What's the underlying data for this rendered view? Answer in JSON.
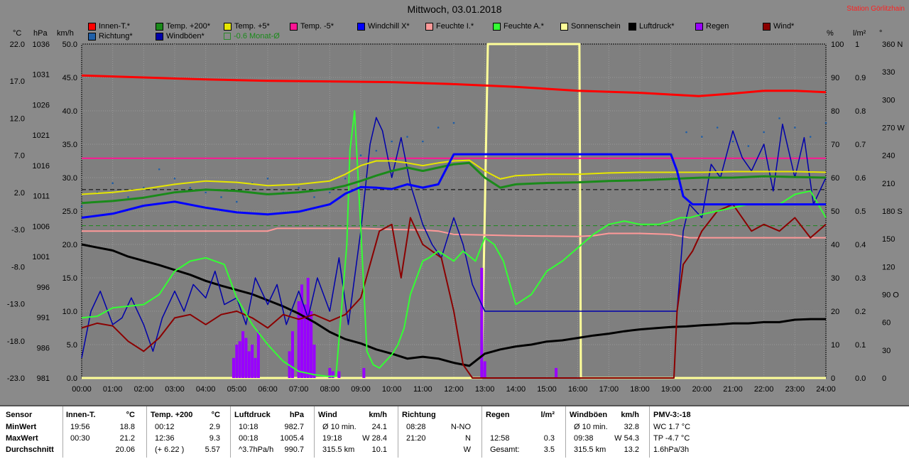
{
  "title": "Mittwoch, 03.01.2018",
  "station": "Station Görlitzhain",
  "units": {
    "c": "°C",
    "hpa": "hPa",
    "kmh": "km/h",
    "pct": "%",
    "lm2": "l/m²",
    "deg": "°"
  },
  "legend": [
    {
      "label": "Innen-T.*",
      "color": "#ff0000"
    },
    {
      "label": "Temp. +200*",
      "color": "#1a8a1a"
    },
    {
      "label": "Temp. +5*",
      "color": "#e6e600"
    },
    {
      "label": "Temp. -5*",
      "color": "#ff1493"
    },
    {
      "label": "Windchill X*",
      "color": "#0000ff"
    },
    {
      "label": "Feuchte I.*",
      "color": "#ff9999"
    },
    {
      "label": "Feuchte A.*",
      "color": "#33ff33"
    },
    {
      "label": "Sonnenschein",
      "color": "#ffff99"
    },
    {
      "label": "Luftdruck*",
      "color": "#000000"
    },
    {
      "label": "Regen",
      "color": "#9900ff"
    },
    {
      "label": "Wind*",
      "color": "#8b0000"
    },
    {
      "label": "Richtung*",
      "color": "#1f5fa8"
    },
    {
      "label": "Windböen*",
      "color": "#0000aa"
    },
    {
      "label": "-0.6 Monat-Ø",
      "color": "#1a8a1a"
    }
  ],
  "chart_data": {
    "type": "line",
    "title": "Mittwoch, 03.01.2018",
    "x_ticks": [
      "00:00",
      "01:00",
      "02:00",
      "03:00",
      "04:00",
      "05:00",
      "06:00",
      "07:00",
      "08:00",
      "09:00",
      "10:00",
      "11:00",
      "12:00",
      "13:00",
      "14:00",
      "15:00",
      "16:00",
      "17:00",
      "18:00",
      "19:00",
      "20:00",
      "21:00",
      "22:00",
      "23:00",
      "24:00"
    ],
    "axes": {
      "temp_c": {
        "ticks": [
          "22.0",
          "17.0",
          "12.0",
          "7.0",
          "2.0",
          "-3.0",
          "-8.0",
          "-13.0",
          "-18.0",
          "-23.0"
        ],
        "ylim": [
          -23,
          22
        ]
      },
      "pressure_hpa": {
        "ticks": [
          "1036",
          "1031",
          "1026",
          "1021",
          "1016",
          "1011",
          "1006",
          "1001",
          "996",
          "991",
          "986",
          "981"
        ],
        "ylim": [
          981,
          1036
        ]
      },
      "wind_kmh": {
        "ticks": [
          "50.0",
          "45.0",
          "40.0",
          "35.0",
          "30.0",
          "25.0",
          "20.0",
          "15.0",
          "10.0",
          "5.0",
          "0.0"
        ],
        "ylim": [
          0,
          50
        ]
      },
      "humidity_pct": {
        "ticks": [
          "100",
          "90",
          "80",
          "70",
          "60",
          "50",
          "40",
          "30",
          "20",
          "10",
          "0"
        ],
        "ylim": [
          0,
          100
        ]
      },
      "rain_lm2": {
        "ticks": [
          "1",
          "0.9",
          "0.8",
          "0.7",
          "0.6",
          "0.5",
          "0.4",
          "0.3",
          "0.2",
          "0.1",
          "0.0"
        ],
        "ylim": [
          0,
          1
        ]
      },
      "direction_deg": {
        "ticks": [
          "360 N",
          "330",
          "300",
          "270 W",
          "240",
          "210",
          "180 S",
          "150",
          "120",
          "90 O",
          "60",
          "30",
          "0"
        ],
        "ylim": [
          0,
          360
        ]
      }
    },
    "series": [
      {
        "name": "Innen-T.*",
        "axis": "wind_kmh",
        "x": [
          0,
          2,
          4,
          6,
          8,
          10,
          12,
          14,
          16,
          18,
          19.9,
          21,
          22,
          23,
          24
        ],
        "y": [
          45.3,
          45.0,
          44.7,
          44.5,
          44.4,
          44.3,
          44.0,
          43.6,
          43.0,
          42.7,
          42.2,
          42.6,
          43.0,
          43.0,
          42.8
        ]
      },
      {
        "name": "Temp. +200*",
        "axis": "wind_kmh",
        "x": [
          0,
          1,
          2,
          3,
          4,
          5,
          6,
          7,
          8,
          8.5,
          9,
          9.5,
          10,
          10.5,
          11,
          11.5,
          12,
          12.5,
          13,
          13.5,
          14,
          15,
          16,
          17,
          18,
          19,
          19.5,
          20,
          21,
          22,
          23,
          24
        ],
        "y": [
          26.2,
          26.5,
          27.0,
          27.8,
          28.2,
          28.0,
          27.5,
          27.8,
          28.3,
          28.8,
          29.5,
          30.3,
          31.0,
          31.5,
          31.0,
          31.5,
          32.0,
          32.2,
          30.0,
          28.5,
          29.0,
          29.2,
          29.3,
          29.5,
          29.6,
          29.8,
          29.9,
          30.0,
          30.0,
          30.2,
          30.1,
          30.0
        ]
      },
      {
        "name": "Temp. +5*",
        "axis": "wind_kmh",
        "x": [
          0,
          1,
          2,
          3,
          4,
          5,
          6,
          7,
          8,
          8.5,
          9,
          9.5,
          10,
          10.5,
          11,
          11.5,
          12,
          12.5,
          13,
          13.5,
          14,
          15,
          16,
          17,
          18,
          19,
          20,
          21,
          22,
          23,
          24
        ],
        "y": [
          27.5,
          27.8,
          28.3,
          29.0,
          29.5,
          29.3,
          28.8,
          29.0,
          29.5,
          30.5,
          31.8,
          32.5,
          32.5,
          32.2,
          31.8,
          32.2,
          32.5,
          32.6,
          31.0,
          29.8,
          30.3,
          30.5,
          30.5,
          30.7,
          30.8,
          30.8,
          30.8,
          30.9,
          30.9,
          30.9,
          30.8
        ]
      },
      {
        "name": "Temp. -5*",
        "axis": "wind_kmh",
        "x": [
          0,
          24
        ],
        "y": [
          32.9,
          32.9
        ]
      },
      {
        "name": "Windchill X*",
        "axis": "wind_kmh",
        "x": [
          0,
          1,
          2,
          3,
          4,
          5,
          6,
          7,
          8,
          8.5,
          9,
          9.5,
          10,
          10.5,
          11,
          11.5,
          12,
          13,
          14,
          15,
          16,
          17,
          18,
          19,
          19.2,
          19.4,
          19.7,
          20,
          21,
          22,
          23,
          24
        ],
        "y": [
          24.0,
          24.6,
          25.8,
          26.4,
          25.5,
          24.8,
          24.5,
          24.9,
          26.0,
          27.6,
          28.6,
          28.5,
          28.3,
          29.0,
          28.5,
          29.0,
          33.5,
          33.5,
          33.5,
          33.5,
          33.5,
          33.5,
          33.5,
          33.5,
          31.0,
          27.2,
          26.0,
          26.0,
          26.0,
          26.0,
          26.0,
          26.0
        ]
      },
      {
        "name": "Feuchte I.*",
        "axis": "humidity_pct",
        "x": [
          0,
          6,
          6.3,
          8,
          9,
          10,
          11,
          11.5,
          12,
          13,
          14,
          15,
          16,
          16.5,
          17,
          18,
          19,
          19.6,
          20,
          21,
          22,
          23,
          24
        ],
        "y": [
          44,
          44,
          44.8,
          44.8,
          44.8,
          44.5,
          44.3,
          44,
          43,
          42.8,
          42.6,
          42.5,
          42.4,
          42.6,
          43.3,
          43.3,
          43.0,
          42,
          42,
          42,
          42,
          42,
          42
        ]
      },
      {
        "name": "Feuchte A.*",
        "axis": "humidity_pct",
        "x": [
          0,
          0.5,
          1,
          2,
          2.5,
          3,
          3.5,
          4,
          4.6,
          5,
          5.5,
          6,
          6.5,
          7,
          7.5,
          7.9,
          8.2,
          8.55,
          8.65,
          8.8,
          9,
          9.2,
          9.4,
          9.6,
          9.8,
          10,
          10.2,
          10.4,
          10.6,
          10.8,
          11,
          11.2,
          11.5,
          12,
          12.3,
          12.7,
          13,
          13.3,
          13.6,
          14,
          14.5,
          15,
          15.5,
          16,
          16.5,
          17,
          17.5,
          18,
          18.3,
          18.6,
          19,
          19.3,
          19.6,
          20,
          20.5,
          21,
          21.5,
          22,
          22.5,
          23,
          23.5,
          24
        ],
        "y": [
          18,
          18.5,
          21,
          22,
          25,
          32,
          35,
          36,
          34,
          24,
          16,
          10,
          5,
          2,
          1,
          0.5,
          0.5,
          40,
          68,
          80,
          45,
          8,
          4,
          3,
          5,
          7,
          10,
          15,
          25,
          30,
          35,
          36,
          38,
          35,
          38,
          35,
          42,
          40,
          35,
          22,
          25,
          32,
          35,
          39,
          43,
          46,
          47,
          46,
          46,
          46,
          47,
          48,
          48,
          49,
          50,
          51,
          52,
          52,
          52,
          55,
          56,
          48
        ]
      },
      {
        "name": "Sonnenschein",
        "axis": "humidity_pct",
        "x": [
          0,
          12.9,
          13.0,
          13.1,
          16.05,
          16.1,
          24
        ],
        "y": [
          0,
          0,
          50,
          100,
          100,
          0,
          0
        ]
      },
      {
        "name": "Luftdruck*",
        "axis": "pressure_hpa",
        "x": [
          0,
          0.5,
          1,
          1.5,
          2,
          2.5,
          3,
          3.5,
          4,
          4.5,
          5,
          5.5,
          6,
          6.5,
          7,
          7.5,
          8,
          8.5,
          9,
          9.5,
          10,
          10.5,
          11,
          11.5,
          12,
          12.5,
          13,
          13.5,
          14,
          14.5,
          15,
          15.5,
          16,
          16.5,
          17,
          17.5,
          18,
          18.5,
          19,
          19.5,
          20,
          20.5,
          21,
          21.5,
          22,
          22.5,
          23,
          23.5,
          24
        ],
        "y": [
          1003,
          1002.5,
          1002,
          1001,
          1000.3,
          999.6,
          998.8,
          998,
          997,
          996.2,
          995.5,
          994.8,
          993.8,
          992.8,
          991.6,
          990.2,
          988.6,
          987.4,
          986.7,
          985.7,
          985.0,
          984.2,
          984.5,
          984.2,
          983.5,
          983.0,
          985.0,
          985.7,
          986.2,
          986.5,
          987.0,
          987.2,
          987.6,
          988.0,
          988.3,
          988.7,
          989.0,
          989.2,
          989.4,
          989.5,
          989.7,
          989.8,
          990.0,
          990.0,
          990.2,
          990.2,
          990.6,
          990.7,
          990.7
        ]
      },
      {
        "name": "Wind*",
        "axis": "wind_kmh",
        "x": [
          0,
          0.5,
          1,
          1.5,
          2,
          2.5,
          3,
          3.5,
          4,
          4.5,
          5,
          5.5,
          6,
          6.5,
          7,
          7.5,
          8,
          8.5,
          9,
          9.3,
          9.6,
          10,
          10.3,
          10.6,
          11,
          11.3,
          11.6,
          12,
          12.3,
          12.6,
          13,
          13.5,
          14,
          15,
          16,
          17,
          18,
          19.0,
          19.1,
          19.2,
          19.4,
          19.7,
          20,
          20.5,
          21,
          21.3,
          21.6,
          22,
          22.5,
          23,
          23.5,
          24
        ],
        "y": [
          7.5,
          8.2,
          7.8,
          5.5,
          4,
          6,
          9,
          9.5,
          8,
          9.5,
          10,
          9.0,
          7.5,
          9.5,
          8.8,
          9.5,
          8.5,
          9.5,
          12,
          17,
          22,
          23,
          15,
          24,
          20,
          19,
          18,
          10,
          2,
          0,
          0,
          0,
          0,
          0,
          0,
          0,
          0,
          0,
          0,
          10,
          17,
          19,
          22,
          25,
          26,
          24,
          22,
          23,
          22,
          24,
          21,
          23
        ]
      },
      {
        "name": "Windböen*",
        "axis": "wind_kmh",
        "x": [
          0,
          0.3,
          0.6,
          1,
          1.3,
          1.6,
          2,
          2.3,
          2.6,
          3,
          3.3,
          3.6,
          4,
          4.3,
          4.6,
          5,
          5.3,
          5.6,
          6,
          6.3,
          6.6,
          7,
          7.3,
          7.6,
          8,
          8.3,
          8.6,
          9,
          9.3,
          9.5,
          9.7,
          10,
          10.3,
          10.6,
          11,
          11.3,
          11.6,
          12,
          12.3,
          12.6,
          13,
          19.2,
          19.4,
          19.6,
          20,
          20.3,
          20.6,
          21,
          21.3,
          21.6,
          22,
          22.3,
          22.6,
          23,
          23.3,
          23.6,
          24
        ],
        "y": [
          3,
          10,
          13,
          8,
          9,
          12,
          8,
          4,
          9,
          13,
          10,
          14,
          12,
          16,
          11,
          12,
          8,
          15,
          11,
          14,
          8,
          13,
          9,
          15,
          10,
          18,
          8,
          22,
          35,
          39,
          37,
          30,
          36,
          29,
          23,
          20,
          18,
          24,
          20,
          14,
          10,
          10,
          22,
          26,
          24,
          32,
          30,
          37,
          33,
          31,
          35,
          28,
          38,
          30,
          36,
          26,
          30
        ]
      },
      {
        "name": "Regen",
        "axis": "rain_lm2",
        "type": "bar",
        "x": [
          4.9,
          5,
          5.1,
          5.2,
          5.3,
          5.4,
          5.5,
          5.6,
          5.7,
          6.7,
          6.8,
          7.0,
          7.1,
          7.2,
          7.3,
          7.4,
          7.5,
          8.0,
          8.1,
          8.3,
          9.1,
          12.9,
          13.0,
          15.3
        ],
        "y": [
          0.06,
          0.1,
          0.11,
          0.14,
          0.12,
          0.08,
          0.1,
          0.06,
          0.14,
          0.08,
          0.14,
          0.23,
          0.28,
          0.22,
          0.3,
          0.2,
          0.1,
          0.03,
          0.02,
          0.02,
          0.03,
          0.33,
          0.05,
          0.03
        ]
      },
      {
        "name": "Richtung*",
        "axis": "direction_deg",
        "type": "scatter",
        "x": [
          0,
          0.5,
          1,
          1.5,
          2,
          2.5,
          3,
          3.5,
          4,
          4.5,
          5,
          5.5,
          6,
          6.5,
          7,
          7.5,
          8,
          8.5,
          9,
          9.5,
          10,
          10.5,
          11,
          11.5,
          12,
          19.5,
          20,
          20.5,
          21,
          21.5,
          22,
          22.5,
          23,
          23.5,
          24
        ],
        "y": [
          185,
          200,
          210,
          195,
          205,
          225,
          215,
          205,
          200,
          195,
          190,
          210,
          215,
          200,
          205,
          195,
          200,
          215,
          240,
          245,
          255,
          260,
          255,
          270,
          275,
          265,
          260,
          270,
          255,
          250,
          265,
          280,
          270,
          260,
          275
        ]
      }
    ],
    "reference_lines": [
      {
        "axis": "wind_kmh",
        "y": 28.2,
        "style": "dashed",
        "color": "#000000"
      },
      {
        "axis": "wind_kmh",
        "y": 22.8,
        "style": "dashed",
        "color": "#1a8a1a"
      }
    ],
    "grid": true
  },
  "stats": {
    "col_sensor": {
      "header": "Sensor",
      "rows": [
        "MinWert",
        "MaxWert",
        "Durchschnitt"
      ]
    },
    "innen": {
      "header": "Innen-T.",
      "unit": "°C",
      "times": [
        "19:56",
        "00:30",
        ""
      ],
      "values": [
        "18.8",
        "21.2",
        "20.06"
      ]
    },
    "temp200": {
      "header": "Temp. +200",
      "unit": "°C",
      "times": [
        "00:12",
        "12:36",
        "(+ 6.22 )"
      ],
      "values": [
        "2.9",
        "9.3",
        "5.57"
      ]
    },
    "luftdruck": {
      "header": "Luftdruck",
      "unit": "hPa",
      "times": [
        "10:18",
        "00:18",
        "^3.7hPa/h"
      ],
      "values": [
        "982.7",
        "1005.4",
        "990.7"
      ]
    },
    "wind": {
      "header": "Wind",
      "unit": "km/h",
      "times": [
        "Ø 10 min.",
        "19:18",
        "315.5 km"
      ],
      "values": [
        "24.1",
        "W 28.4",
        "10.1"
      ]
    },
    "richtung": {
      "header": "Richtung",
      "times": [
        "08:28",
        "21:20",
        ""
      ],
      "values": [
        "N-NO",
        "N",
        "W"
      ]
    },
    "regen": {
      "header": "Regen",
      "unit": "l/m²",
      "times": [
        "",
        "12:58",
        "Gesamt:"
      ],
      "values": [
        "",
        "0.3",
        "3.5"
      ]
    },
    "windboeen": {
      "header": "Windböen",
      "unit": "km/h",
      "times": [
        "Ø 10 min.",
        "09:38",
        "315.5 km"
      ],
      "values": [
        "32.8",
        "W 54.3",
        "13.2"
      ]
    },
    "pmv": {
      "header": "PMV-3:-18",
      "rows": [
        "WC 1.7 °C",
        "TP -4.7 °C",
        "1.6hPa/3h"
      ]
    }
  }
}
